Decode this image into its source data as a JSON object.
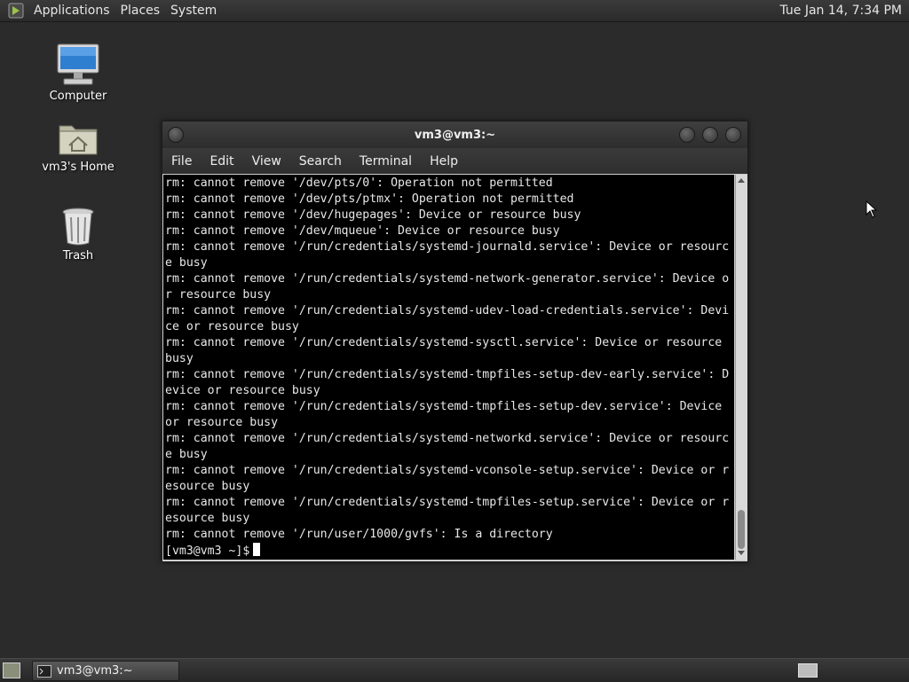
{
  "top_panel": {
    "menus": [
      "Applications",
      "Places",
      "System"
    ],
    "clock": "Tue Jan 14,  7:34 PM"
  },
  "desktop": {
    "icons": [
      {
        "label": "Computer",
        "icon": "computer-icon"
      },
      {
        "label": "vm3's Home",
        "icon": "home-folder-icon"
      },
      {
        "label": "Trash",
        "icon": "trash-icon"
      }
    ]
  },
  "terminal": {
    "title": "vm3@vm3:~",
    "menus": [
      "File",
      "Edit",
      "View",
      "Search",
      "Terminal",
      "Help"
    ],
    "lines": [
      "rm: cannot remove '/dev/pts/0': Operation not permitted",
      "rm: cannot remove '/dev/pts/ptmx': Operation not permitted",
      "rm: cannot remove '/dev/hugepages': Device or resource busy",
      "rm: cannot remove '/dev/mqueue': Device or resource busy",
      "rm: cannot remove '/run/credentials/systemd-journald.service': Device or resourc",
      "e busy",
      "rm: cannot remove '/run/credentials/systemd-network-generator.service': Device o",
      "r resource busy",
      "rm: cannot remove '/run/credentials/systemd-udev-load-credentials.service': Devi",
      "ce or resource busy",
      "rm: cannot remove '/run/credentials/systemd-sysctl.service': Device or resource",
      "busy",
      "rm: cannot remove '/run/credentials/systemd-tmpfiles-setup-dev-early.service': D",
      "evice or resource busy",
      "rm: cannot remove '/run/credentials/systemd-tmpfiles-setup-dev.service': Device",
      "or resource busy",
      "rm: cannot remove '/run/credentials/systemd-networkd.service': Device or resourc",
      "e busy",
      "rm: cannot remove '/run/credentials/systemd-vconsole-setup.service': Device or r",
      "esource busy",
      "rm: cannot remove '/run/credentials/systemd-tmpfiles-setup.service': Device or r",
      "esource busy",
      "rm: cannot remove '/run/user/1000/gvfs': Is a directory"
    ],
    "prompt": "[vm3@vm3 ~]$"
  },
  "bottom_panel": {
    "task_label": "vm3@vm3:~"
  },
  "colors": {
    "desktop_bg": "#2b2b2b",
    "terminal_bg": "#000000",
    "terminal_fg": "#e8e8e8"
  }
}
